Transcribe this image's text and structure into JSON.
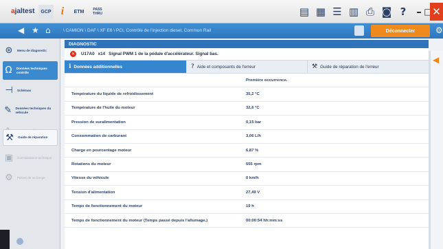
{
  "app": {
    "logo_prefix": "a",
    "logo_rest": "jaltest"
  },
  "toolbar": {
    "btn_gcp": "GCP",
    "btn_info": "i",
    "btn_etm": "ETM",
    "btn_pass": "PASS THRU"
  },
  "window": {
    "minimize": "–",
    "maximize": "□",
    "close": "✕"
  },
  "nav": {
    "breadcrumb": "\\ CAMION \\ DAF \\ XF E6 \\ PCI, Contrôle de l'injection diesel, Common Rail",
    "disconnect_label": "Déconnecter"
  },
  "sidebar": {
    "items": [
      {
        "label": "Menu de diagnostic",
        "state": "normal"
      },
      {
        "label": "Données techniques contrôle",
        "state": "active"
      },
      {
        "label": "Schémas",
        "state": "normal"
      },
      {
        "label": "Données techniques du véhicule",
        "state": "normal"
      },
      {
        "label": "Entretien véhicule",
        "state": "dim"
      },
      {
        "label": "Guide de réparation",
        "state": "bordered"
      },
      {
        "label": "Connaissance technique",
        "state": "dim"
      },
      {
        "label": "Pièces de rechange",
        "state": "dim"
      }
    ]
  },
  "diagnostic": {
    "header": "DIAGNOSTIC",
    "error": {
      "code": "U17A0",
      "sub": "x14",
      "description": "Signal PWM 1 de la pédale d'accélérateur. Signal bas."
    },
    "tabs": [
      {
        "label": "Données additionnelles",
        "active": true
      },
      {
        "label": "Aide et composants de l'erreur",
        "active": false
      },
      {
        "label": "Guide de réparation de l'erreur",
        "active": false
      }
    ],
    "column_header": "Première occurrence.",
    "rows": [
      {
        "label": "Température du liquide de refroidissement",
        "value": "35,2 °C"
      },
      {
        "label": "Température de l'huile du moteur",
        "value": "32,6 °C"
      },
      {
        "label": "Pression de suralimentation",
        "value": "0,15 bar"
      },
      {
        "label": "Consommation de carburant",
        "value": "3,06 L/h"
      },
      {
        "label": "Charge en pourcentage moteur",
        "value": "6,87 %"
      },
      {
        "label": "Rotations du moteur",
        "value": "555 rpm"
      },
      {
        "label": "Vitesse du véhicule",
        "value": "0 km/h"
      },
      {
        "label": "Tension d'alimentation",
        "value": "27,49 V"
      },
      {
        "label": "Temps de fonctionnement du moteur",
        "value": "19 h"
      },
      {
        "label": "Temps de fonctionnement du moteur (Temps passé depuis l'allumage.)",
        "value": "00:00:54 hh:mm:ss"
      }
    ]
  },
  "colors": {
    "accent": "#2f74bb",
    "active_tab": "#3585cf",
    "disconnect": "#f08a1d",
    "close": "#e2401c",
    "error": "#d8321c"
  }
}
